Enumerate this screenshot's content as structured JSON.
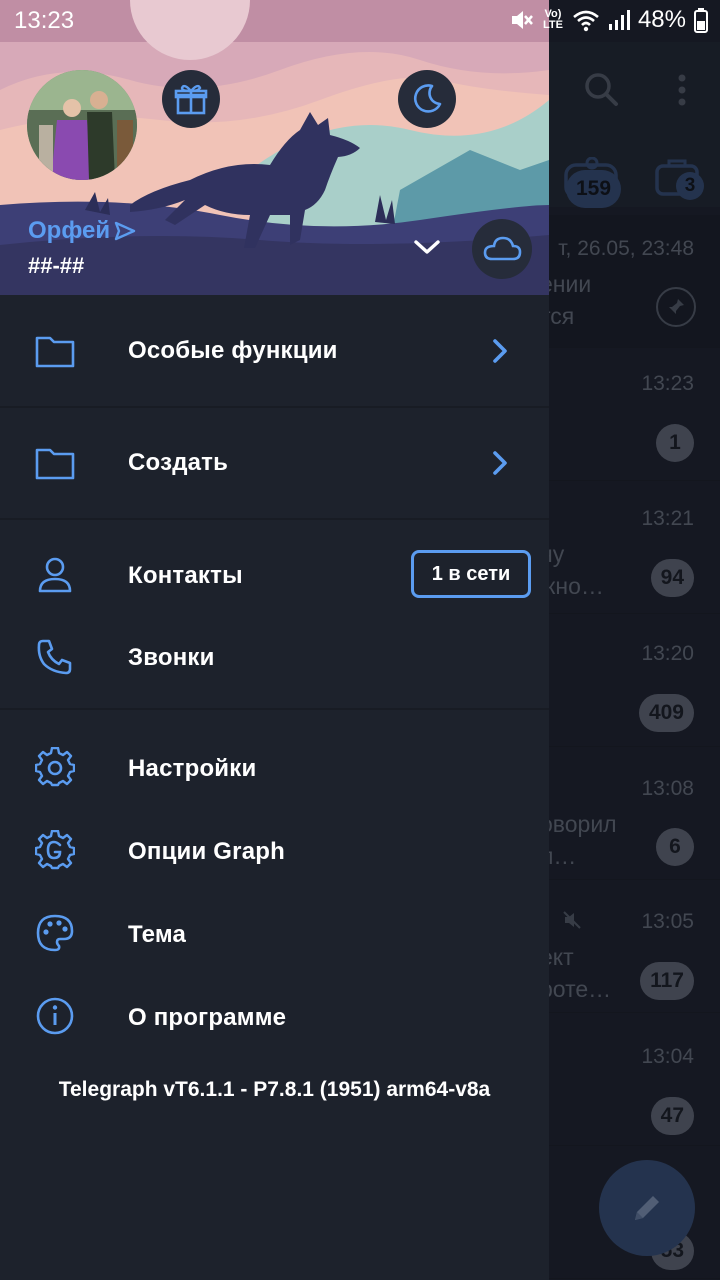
{
  "status_bar": {
    "time": "13:23",
    "network_label": "Vo) LTE",
    "battery": "48%"
  },
  "profile": {
    "name": "Орфей",
    "phone": "##-##"
  },
  "menu": {
    "special_functions": "Особые функции",
    "create": "Создать",
    "contacts": "Контакты",
    "contacts_online_badge": "1 в сети",
    "calls": "Звонки",
    "settings": "Настройки",
    "graph_options": "Опции Graph",
    "theme": "Тема",
    "about": "О программе"
  },
  "version": "Telegraph vT6.1.1 - P7.8.1 (1951) arm64-v8a",
  "background_chats": {
    "topbar_badges": [
      "159",
      "3"
    ],
    "rows": [
      {
        "time": "т, 26.05, 23:48",
        "snippet_1": "ении",
        "snippet_2": "тся",
        "badge": ""
      },
      {
        "time": "13:23",
        "snippet_1": "",
        "snippet_2": "",
        "badge": "1"
      },
      {
        "time": "13:21",
        "snippet_1": "ну",
        "snippet_2": "жно…",
        "badge": "94"
      },
      {
        "time": "13:20",
        "snippet_1": "",
        "snippet_2": "",
        "badge": "409"
      },
      {
        "time": "13:08",
        "snippet_1": "оворил",
        "snippet_2": "л…",
        "badge": "6"
      },
      {
        "time": "13:05",
        "snippet_1": "ект",
        "snippet_2": "роте…",
        "badge": "117"
      },
      {
        "time": "13:04",
        "snippet_1": "",
        "snippet_2": "",
        "badge": "47"
      },
      {
        "time": "",
        "snippet_1": "",
        "snippet_2": "",
        "badge": "53"
      }
    ]
  },
  "colors": {
    "accent": "#5b9cf0",
    "drawer_bg": "#1d222c",
    "text": "#ffffff"
  }
}
